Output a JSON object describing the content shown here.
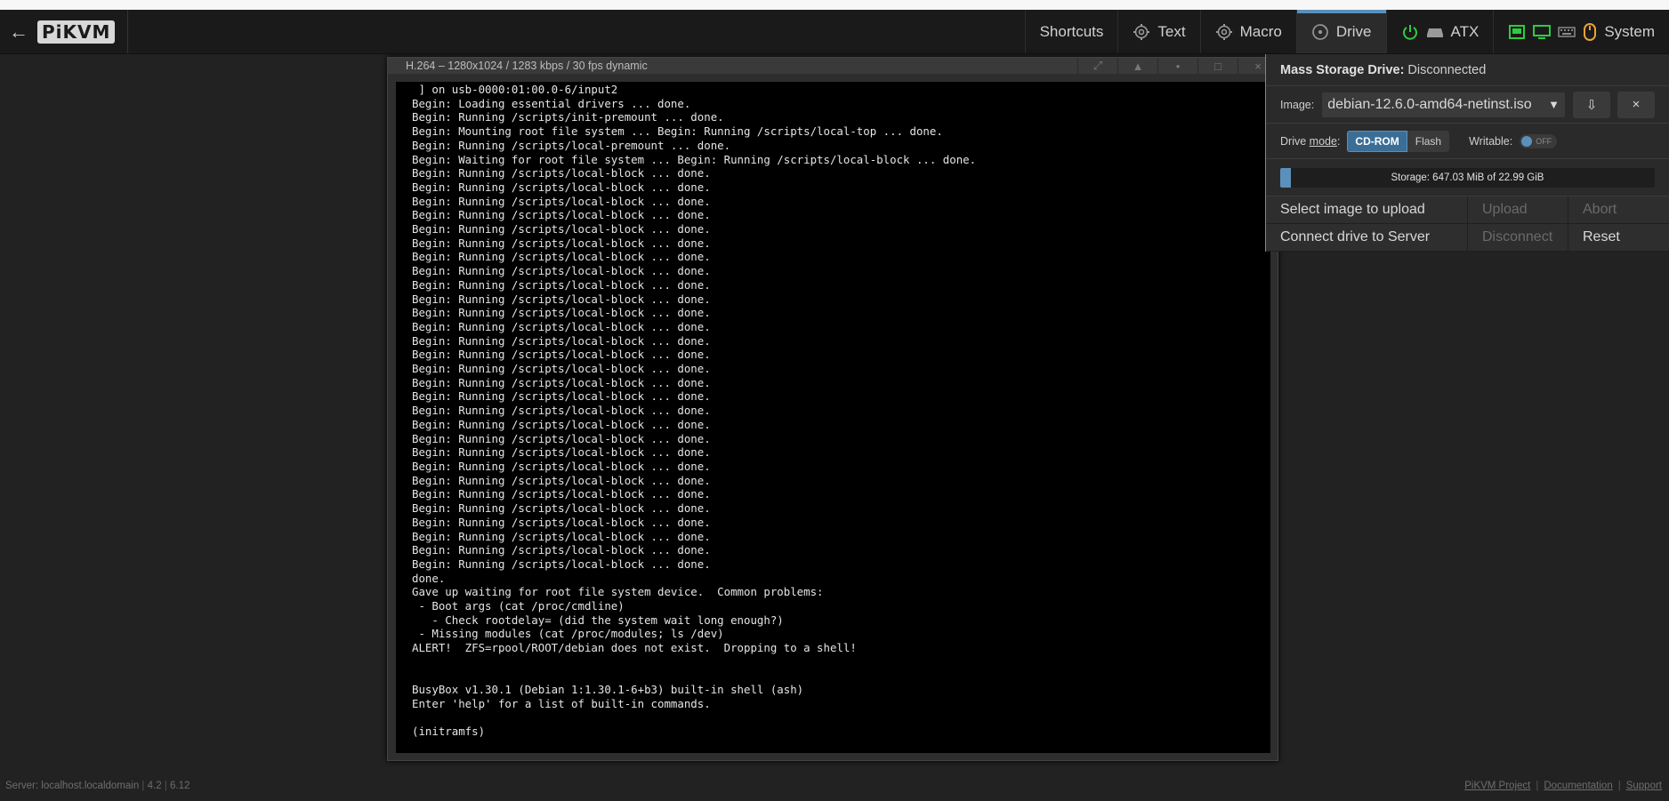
{
  "nav": {
    "back_arrow": "←",
    "logo_text": "PiKVM",
    "items": [
      {
        "label": "Shortcuts",
        "icon": ""
      },
      {
        "label": "Text",
        "icon": "gear-icon"
      },
      {
        "label": "Macro",
        "icon": "gear-icon"
      },
      {
        "label": "Drive",
        "icon": "drive-icon",
        "active": true
      },
      {
        "label": "ATX",
        "icon": "power-icon"
      },
      {
        "label": "System",
        "icon": "network-icon"
      }
    ]
  },
  "stream": {
    "title": "H.264 – 1280x1024 / 1283 kbps / 30 fps dynamic",
    "buttons": {
      "fullscreen": "⤢",
      "screenshot": "▲",
      "dot": "•",
      "maximize": "□",
      "close": "×"
    },
    "terminal_lines": [
      " ] on usb-0000:01:00.0-6/input2",
      "Begin: Loading essential drivers ... done.",
      "Begin: Running /scripts/init-premount ... done.",
      "Begin: Mounting root file system ... Begin: Running /scripts/local-top ... done.",
      "Begin: Running /scripts/local-premount ... done.",
      "Begin: Waiting for root file system ... Begin: Running /scripts/local-block ... done.",
      "Begin: Running /scripts/local-block ... done.",
      "Begin: Running /scripts/local-block ... done.",
      "Begin: Running /scripts/local-block ... done.",
      "Begin: Running /scripts/local-block ... done.",
      "Begin: Running /scripts/local-block ... done.",
      "Begin: Running /scripts/local-block ... done.",
      "Begin: Running /scripts/local-block ... done.",
      "Begin: Running /scripts/local-block ... done.",
      "Begin: Running /scripts/local-block ... done.",
      "Begin: Running /scripts/local-block ... done.",
      "Begin: Running /scripts/local-block ... done.",
      "Begin: Running /scripts/local-block ... done.",
      "Begin: Running /scripts/local-block ... done.",
      "Begin: Running /scripts/local-block ... done.",
      "Begin: Running /scripts/local-block ... done.",
      "Begin: Running /scripts/local-block ... done.",
      "Begin: Running /scripts/local-block ... done.",
      "Begin: Running /scripts/local-block ... done.",
      "Begin: Running /scripts/local-block ... done.",
      "Begin: Running /scripts/local-block ... done.",
      "Begin: Running /scripts/local-block ... done.",
      "Begin: Running /scripts/local-block ... done.",
      "Begin: Running /scripts/local-block ... done.",
      "Begin: Running /scripts/local-block ... done.",
      "Begin: Running /scripts/local-block ... done.",
      "Begin: Running /scripts/local-block ... done.",
      "Begin: Running /scripts/local-block ... done.",
      "Begin: Running /scripts/local-block ... done.",
      "Begin: Running /scripts/local-block ... done.",
      "done.",
      "Gave up waiting for root file system device.  Common problems:",
      " - Boot args (cat /proc/cmdline)",
      "   - Check rootdelay= (did the system wait long enough?)",
      " - Missing modules (cat /proc/modules; ls /dev)",
      "ALERT!  ZFS=rpool/ROOT/debian does not exist.  Dropping to a shell!",
      "",
      "",
      "BusyBox v1.30.1 (Debian 1:1.30.1-6+b3) built-in shell (ash)",
      "Enter 'help' for a list of built-in commands.",
      "",
      "(initramfs)"
    ]
  },
  "drive": {
    "title_bold": "Mass Storage Drive:",
    "status": "Disconnected",
    "image_label": "Image:",
    "image_value": "debian-12.6.0-amd64-netinst.iso",
    "download_icon": "⇩",
    "remove_icon": "×",
    "mode_label_prefix": "Drive ",
    "mode_label_link": "mode",
    "mode_label_suffix": ":",
    "mode_cdrom": "CD-ROM",
    "mode_flash": "Flash",
    "writable_label": "Writable:",
    "writable_state": "OFF",
    "storage_text": "Storage: 647.03 MiB of 22.99 GiB",
    "storage_fraction": 0.0275,
    "actions": {
      "select_image": "Select image to upload",
      "upload": "Upload",
      "abort": "Abort",
      "connect": "Connect drive to Server",
      "disconnect": "Disconnect",
      "reset": "Reset"
    }
  },
  "footer": {
    "server": "Server: localhost.localdomain",
    "version1": "4.2",
    "version2": "6.12",
    "links": [
      "PiKVM Project",
      "Documentation",
      "Support"
    ]
  },
  "colors": {
    "accent": "#5b90bb",
    "power_green": "#2ecc40",
    "mouse_orange": "#e8a23a"
  }
}
